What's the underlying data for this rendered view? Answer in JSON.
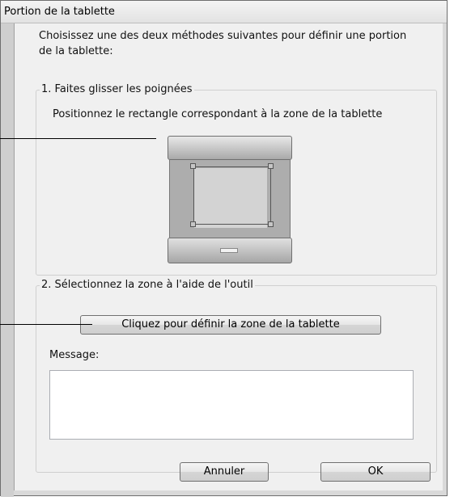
{
  "window": {
    "title": "Portion de la tablette"
  },
  "intro": "Choisissez une des deux méthodes suivantes pour définir une portion de la tablette:",
  "group1": {
    "title": "1. Faites glisser les poignées",
    "description": "Positionnez le rectangle correspondant à la zone de la tablette"
  },
  "group2": {
    "title": "2. Sélectionnez la zone à l'aide de l'outil",
    "define_button": "Cliquez pour définir la zone de la tablette",
    "message_label": "Message:",
    "message_value": ""
  },
  "buttons": {
    "cancel": "Annuler",
    "ok": "OK"
  }
}
